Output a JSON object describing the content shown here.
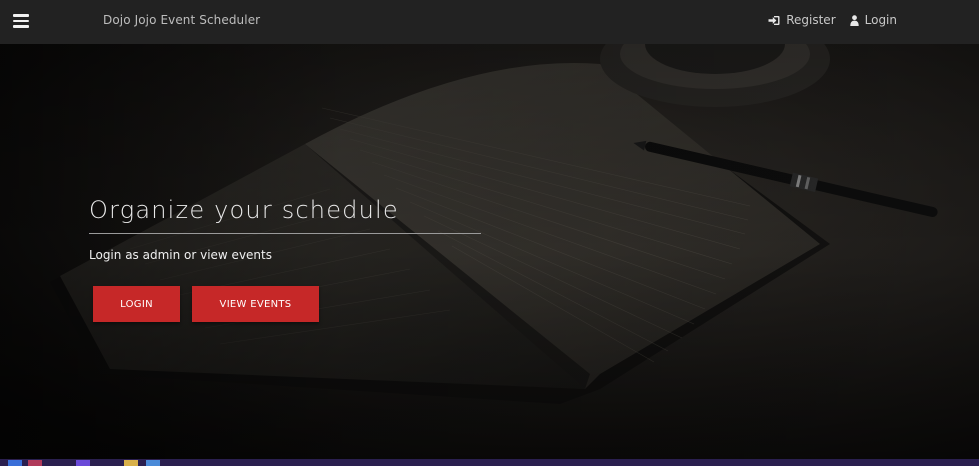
{
  "app": {
    "brand": "Dojo Jojo Event Scheduler"
  },
  "nav": {
    "register_label": "Register",
    "login_label": "Login"
  },
  "hero": {
    "title": "Organize your schedule",
    "subtitle": "Login as admin or view events",
    "login_button": "LOGIN",
    "view_events_button": "VIEW EVENTS"
  },
  "icons": {
    "menu": "hamburger-menu-icon",
    "register": "sign-in-icon",
    "login": "user-icon"
  },
  "colors": {
    "navbar": "#222222",
    "accent": "#c62828",
    "taskbar": "#2a1f4f"
  }
}
